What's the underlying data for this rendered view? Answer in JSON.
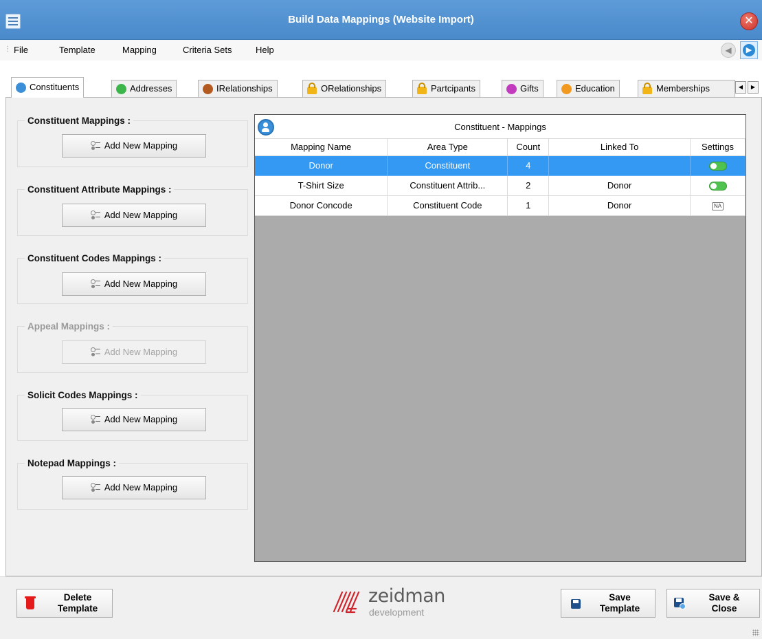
{
  "window": {
    "title": "Build Data Mappings (Website Import)",
    "close_glyph": "✕"
  },
  "menu": {
    "items": [
      "File",
      "Template",
      "Mapping",
      "Criteria Sets",
      "Help"
    ],
    "back_glyph": "◀",
    "forward_glyph": "▶"
  },
  "tabs": [
    {
      "label": "Constituents",
      "icon": "person-icon",
      "color": "#3b8fd8",
      "active": true
    },
    {
      "label": "Addresses",
      "icon": "home-icon",
      "color": "#3cb54a",
      "active": false
    },
    {
      "label": "IRelationships",
      "icon": "relationships-icon",
      "color": "#b25a1f",
      "active": false
    },
    {
      "label": "ORelationships",
      "icon": "lock-icon",
      "color": "#f2b517",
      "active": false
    },
    {
      "label": "Partcipants",
      "icon": "lock-icon",
      "color": "#f2b517",
      "active": false
    },
    {
      "label": "Gifts",
      "icon": "gift-icon",
      "color": "#c23bbf",
      "active": false
    },
    {
      "label": "Education",
      "icon": "education-icon",
      "color": "#f29a1f",
      "active": false
    },
    {
      "label": "Memberships",
      "icon": "lock-icon",
      "color": "#f2b517",
      "active": false
    }
  ],
  "tab_scroll": {
    "left_glyph": "◀",
    "right_glyph": "▶"
  },
  "groups": [
    {
      "title": "Constituent Mappings :",
      "button": "Add New Mapping",
      "enabled": true
    },
    {
      "title": "Constituent Attribute Mappings :",
      "button": "Add New Mapping",
      "enabled": true
    },
    {
      "title": "Constituent Codes Mappings :",
      "button": "Add New Mapping",
      "enabled": true
    },
    {
      "title": "Appeal Mappings :",
      "button": "Add New Mapping",
      "enabled": false
    },
    {
      "title": "Solicit Codes Mappings :",
      "button": "Add New Mapping",
      "enabled": true
    },
    {
      "title": "Notepad Mappings :",
      "button": "Add New Mapping",
      "enabled": true
    }
  ],
  "grid": {
    "caption": "Constituent - Mappings",
    "columns": [
      "Mapping Name",
      "Area Type",
      "Count",
      "Linked To",
      "Settings"
    ],
    "rows": [
      {
        "name": "Donor",
        "area": "Constituent",
        "count": "4",
        "linked": "",
        "settings": "toggle",
        "selected": true
      },
      {
        "name": "T-Shirt Size",
        "area": "Constituent Attrib...",
        "count": "2",
        "linked": "Donor",
        "settings": "toggle",
        "selected": false
      },
      {
        "name": "Donor Concode",
        "area": "Constituent Code",
        "count": "1",
        "linked": "Donor",
        "settings": "NA",
        "selected": false
      }
    ]
  },
  "footer": {
    "delete_line1": "Delete",
    "delete_line2": "Template",
    "save_line1": "Save",
    "save_line2": "Template",
    "saveclose_line1": "Save &",
    "saveclose_line2": "Close",
    "logo_name": "zeidman",
    "logo_sub": "development"
  },
  "colors": {
    "title_bar": "#4a8acb",
    "selection": "#3399f3",
    "grid_bg": "#ababab",
    "logo_red": "#d0242c"
  }
}
